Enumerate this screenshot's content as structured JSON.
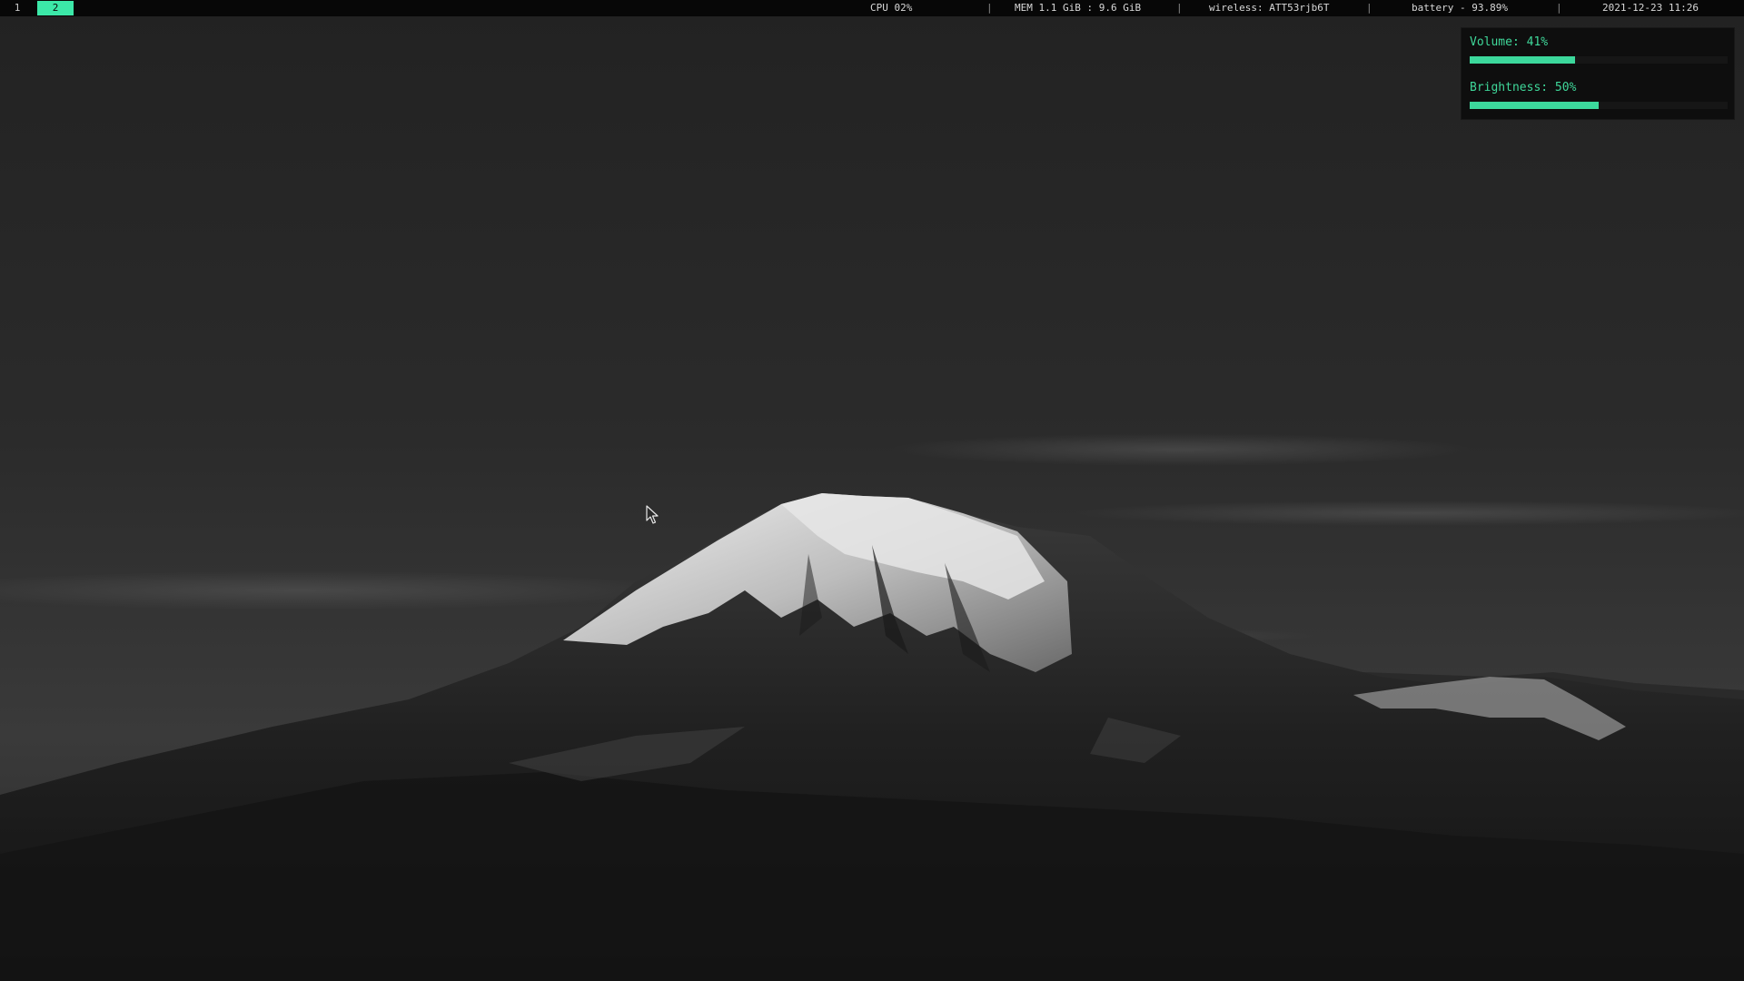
{
  "workspaces": [
    {
      "label": "1",
      "active": false
    },
    {
      "label": "2",
      "active": true
    }
  ],
  "status": {
    "cpu": "CPU 02%",
    "mem": "MEM 1.1 GiB : 9.6 GiB",
    "wireless": "wireless: ATT53rjb6T",
    "battery": "battery - 93.89%",
    "datetime": "2021-12-23 11:26",
    "separator": "|"
  },
  "osd": {
    "volume": {
      "label": "Volume: 41%",
      "level": 0.41
    },
    "brightness": {
      "label": "Brightness: 50%",
      "level": 0.5
    }
  },
  "colors": {
    "accent": "#3ce8a8",
    "bar_bg": "#070707",
    "osd_bg": "#0e0e0e"
  },
  "icons": {
    "cursor": "arrow-cursor-icon"
  }
}
